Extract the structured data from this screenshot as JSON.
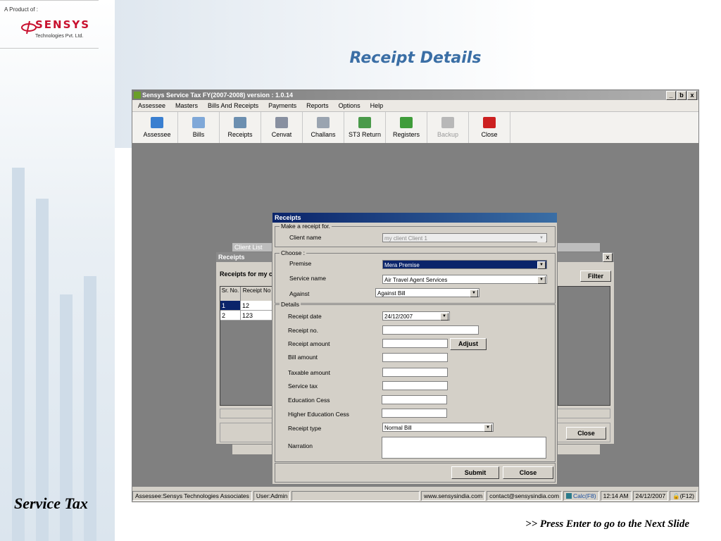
{
  "slide": {
    "logo_top": "A Product of :",
    "logo_brand": "SENSYS",
    "logo_sub": "Technologies Pvt. Ltd.",
    "title": "Receipt Details",
    "footer_left": "Service Tax",
    "footer_right": ">> Press Enter to go to the Next Slide"
  },
  "app": {
    "title": "Sensys Service Tax FY(2007-2008)  version : 1.0.14",
    "window_buttons": [
      "_",
      "ƅ",
      "x"
    ],
    "menu": [
      "Assessee",
      "Masters",
      "Bills And Receipts",
      "Payments",
      "Reports",
      "Options",
      "Help"
    ],
    "toolbar": [
      {
        "label": "Assessee",
        "icon": "assessee-icon",
        "color": "#3a7fd0",
        "disabled": false
      },
      {
        "label": "Bills",
        "icon": "bills-icon",
        "color": "#7fa8d8",
        "disabled": false
      },
      {
        "label": "Receipts",
        "icon": "receipts-icon",
        "color": "#6c8fb0",
        "disabled": false
      },
      {
        "label": "Cenvat",
        "icon": "cenvat-icon",
        "color": "#8890a0",
        "disabled": false
      },
      {
        "label": "Challans",
        "icon": "challans-icon",
        "color": "#9aa4b0",
        "disabled": false
      },
      {
        "label": "ST3 Return",
        "icon": "st3-return-icon",
        "color": "#4a9a4a",
        "disabled": false
      },
      {
        "label": "Registers",
        "icon": "registers-icon",
        "color": "#3f9c3a",
        "disabled": false
      },
      {
        "label": "Backup",
        "icon": "backup-icon",
        "color": "#b8b8b8",
        "disabled": true
      },
      {
        "label": "Close",
        "icon": "close-power-icon",
        "color": "#cc2020",
        "disabled": false
      }
    ],
    "status": {
      "assessee": "Assessee:Sensys Technologies  Associates",
      "user": "User:Admin",
      "web": "www.sensysindia.com",
      "email": "contact@sensysindia.com",
      "calc": "Calc(F8)",
      "time": "12:14 AM",
      "date": "24/12/2007",
      "lock": "(F12)"
    }
  },
  "client_list": {
    "title": "Client List"
  },
  "receipts_bg": {
    "title": "Receipts",
    "heading": "Receipts for my c",
    "col_sr": "Sr. No.",
    "col_receipt": "Receipt No",
    "rows": [
      {
        "sr": "1",
        "receipt": "12"
      },
      {
        "sr": "2",
        "receipt": "123"
      }
    ],
    "filter_label": "Filter",
    "close_label": "Close",
    "x_label": "x"
  },
  "dialog": {
    "title": "Receipts",
    "make_receipt_for": "Make a receipt for.",
    "client_name_label": "Client name",
    "client_name_value": "my client Client 1",
    "choose_legend": "Choose :",
    "premise_label": "Premise",
    "premise_value": "Mera Premise",
    "service_label": "Service name",
    "service_value": "Air Travel Agent Services",
    "against_label": "Against",
    "against_value": "Against Bill",
    "details_legend": "Details",
    "receipt_date_label": "Receipt date",
    "receipt_date_value": "24/12/2007",
    "receipt_no_label": "Receipt no.",
    "receipt_amount_label": "Receipt amount",
    "adjust_label": "Adjust",
    "bill_amount_label": "Bill amount",
    "taxable_amount_label": "Taxable amount",
    "service_tax_label": "Service tax",
    "education_cess_label": "Education Cess",
    "higher_education_cess_label": "Higher Education Cess",
    "receipt_type_label": "Receipt type",
    "receipt_type_value": "Normal Bill",
    "narration_label": "Narration",
    "submit_label": "Submit",
    "close_label": "Close"
  }
}
